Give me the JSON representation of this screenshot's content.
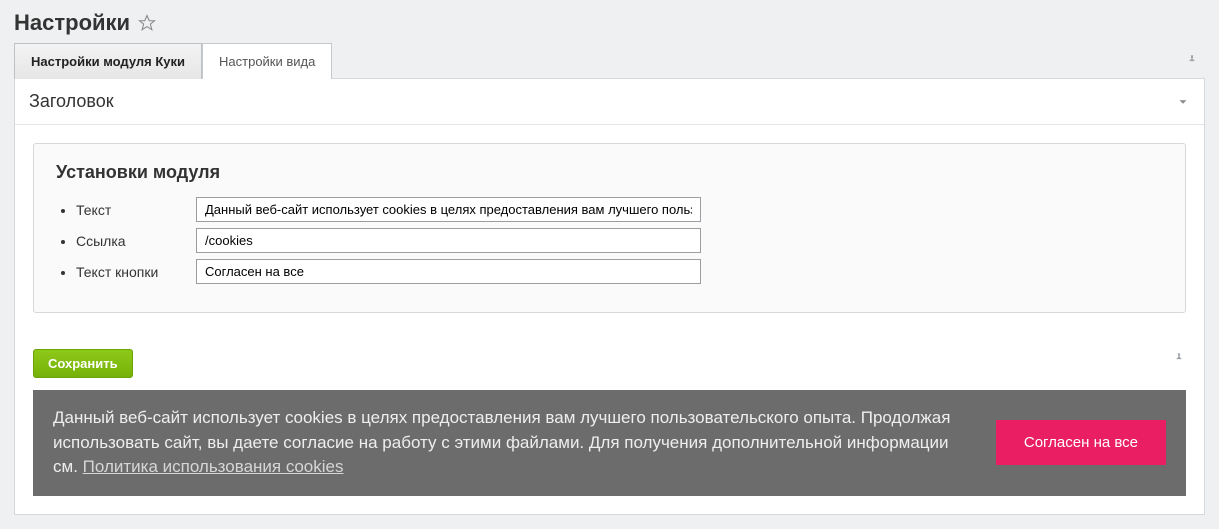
{
  "header": {
    "title": "Настройки"
  },
  "tabs": [
    {
      "label": "Настройки модуля Куки",
      "active": true
    },
    {
      "label": "Настройки вида",
      "active": false
    }
  ],
  "section": {
    "title": "Заголовок"
  },
  "fieldset": {
    "title": "Установки модуля",
    "fields": {
      "text": {
        "label": "Текст",
        "value": "Данный веб-сайт использует cookies в целях предоставления вам лучшего пользовательского опыта."
      },
      "link": {
        "label": "Ссылка",
        "value": "/cookies"
      },
      "btn": {
        "label": "Текст кнопки",
        "value": "Согласен на все"
      }
    }
  },
  "actions": {
    "save_label": "Сохранить"
  },
  "banner": {
    "text_before_link": "Данный веб-сайт использует cookies в целях предоставления вам лучшего пользовательского опыта. Продолжая использовать сайт, вы даете согласие на работу с этими файлами. Для получения дополнительной информации см. ",
    "link_text": "Политика использования cookies",
    "button_label": "Согласен на все"
  }
}
